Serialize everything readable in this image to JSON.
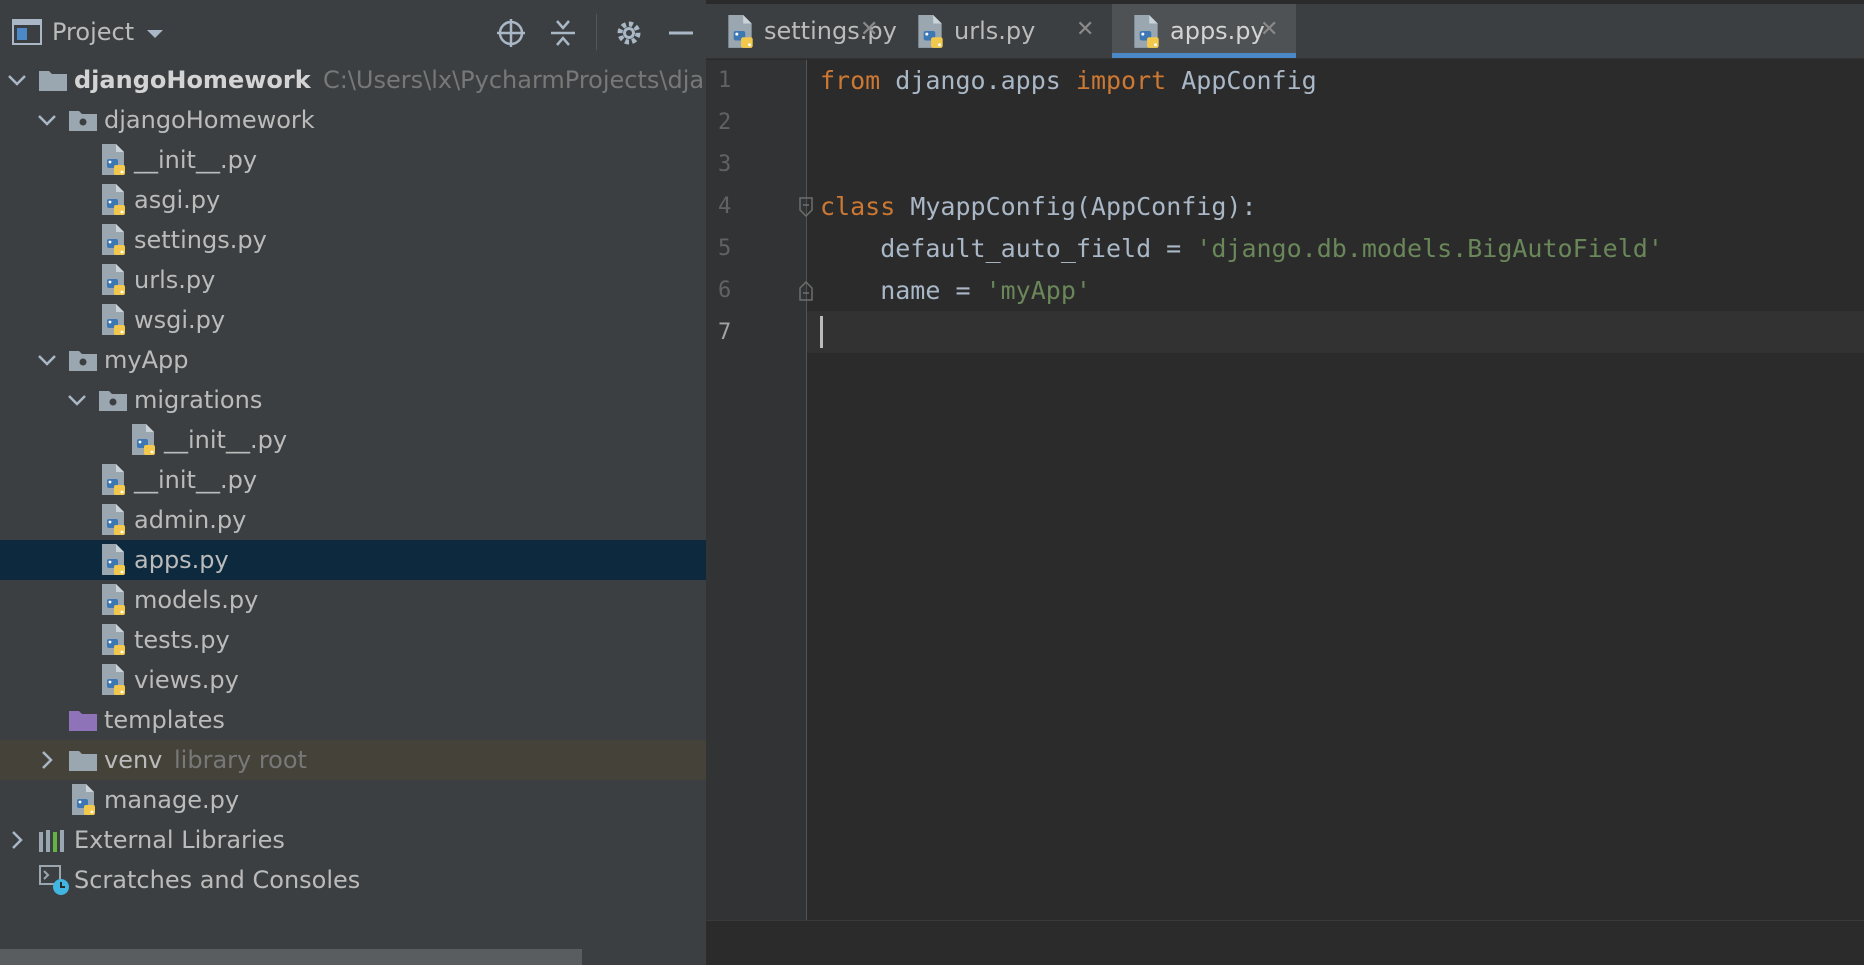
{
  "project_panel": {
    "title": "Project",
    "buttons": [
      "locate-icon",
      "collapse-all-icon",
      "gear-icon",
      "hide-icon"
    ]
  },
  "tree": [
    {
      "depth": 0,
      "expanded": true,
      "type": "project-folder",
      "label": "djangoHomework",
      "bold": true,
      "hint": "C:\\Users\\lx\\PycharmProjects\\djang"
    },
    {
      "depth": 1,
      "expanded": true,
      "type": "package-folder",
      "label": "djangoHomework"
    },
    {
      "depth": 2,
      "type": "python-file",
      "label": "__init__.py"
    },
    {
      "depth": 2,
      "type": "python-file",
      "label": "asgi.py"
    },
    {
      "depth": 2,
      "type": "python-file",
      "label": "settings.py"
    },
    {
      "depth": 2,
      "type": "python-file",
      "label": "urls.py"
    },
    {
      "depth": 2,
      "type": "python-file",
      "label": "wsgi.py"
    },
    {
      "depth": 1,
      "expanded": true,
      "type": "package-folder",
      "label": "myApp"
    },
    {
      "depth": 2,
      "expanded": true,
      "type": "package-folder",
      "label": "migrations"
    },
    {
      "depth": 3,
      "type": "python-file",
      "label": "__init__.py"
    },
    {
      "depth": 2,
      "type": "python-file",
      "label": "__init__.py"
    },
    {
      "depth": 2,
      "type": "python-file",
      "label": "admin.py"
    },
    {
      "depth": 2,
      "type": "python-file",
      "label": "apps.py",
      "selected": true
    },
    {
      "depth": 2,
      "type": "python-file",
      "label": "models.py"
    },
    {
      "depth": 2,
      "type": "python-file",
      "label": "tests.py"
    },
    {
      "depth": 2,
      "type": "python-file",
      "label": "views.py"
    },
    {
      "depth": 1,
      "type": "templates-folder",
      "label": "templates"
    },
    {
      "depth": 1,
      "expanded": false,
      "type": "plain-folder",
      "label": "venv",
      "hint": "library root",
      "library": true
    },
    {
      "depth": 1,
      "type": "python-file",
      "label": "manage.py"
    },
    {
      "depth": 0,
      "expanded": false,
      "type": "libraries",
      "label": "External Libraries"
    },
    {
      "depth": 0,
      "type": "scratches",
      "label": "Scratches and Consoles"
    }
  ],
  "tabs": [
    {
      "label": "settings.py",
      "active": false
    },
    {
      "label": "urls.py",
      "active": false
    },
    {
      "label": "apps.py",
      "active": true
    }
  ],
  "editor": {
    "line_numbers": [
      "1",
      "2",
      "3",
      "4",
      "5",
      "6",
      "7"
    ],
    "current_line": 7,
    "lines": [
      [
        {
          "t": "kw",
          "v": "from"
        },
        {
          "t": "pl",
          "v": " django.apps "
        },
        {
          "t": "kw",
          "v": "import"
        },
        {
          "t": "pl",
          "v": " AppConfig"
        }
      ],
      [],
      [],
      [
        {
          "t": "kw",
          "v": "class"
        },
        {
          "t": "pl",
          "v": " MyappConfig(AppConfig):"
        }
      ],
      [
        {
          "t": "pl",
          "v": "    default_auto_field = "
        },
        {
          "t": "str",
          "v": "'django.db.models.BigAutoField'"
        }
      ],
      [
        {
          "t": "pl",
          "v": "    name = "
        },
        {
          "t": "str",
          "v": "'myApp'"
        }
      ],
      []
    ]
  },
  "colors": {
    "panel_bg": "#3c3f41",
    "editor_bg": "#2b2b2b",
    "selection": "#0d293e",
    "keyword": "#cc7832",
    "string": "#6a8759",
    "tab_underline": "#4a88c7"
  }
}
